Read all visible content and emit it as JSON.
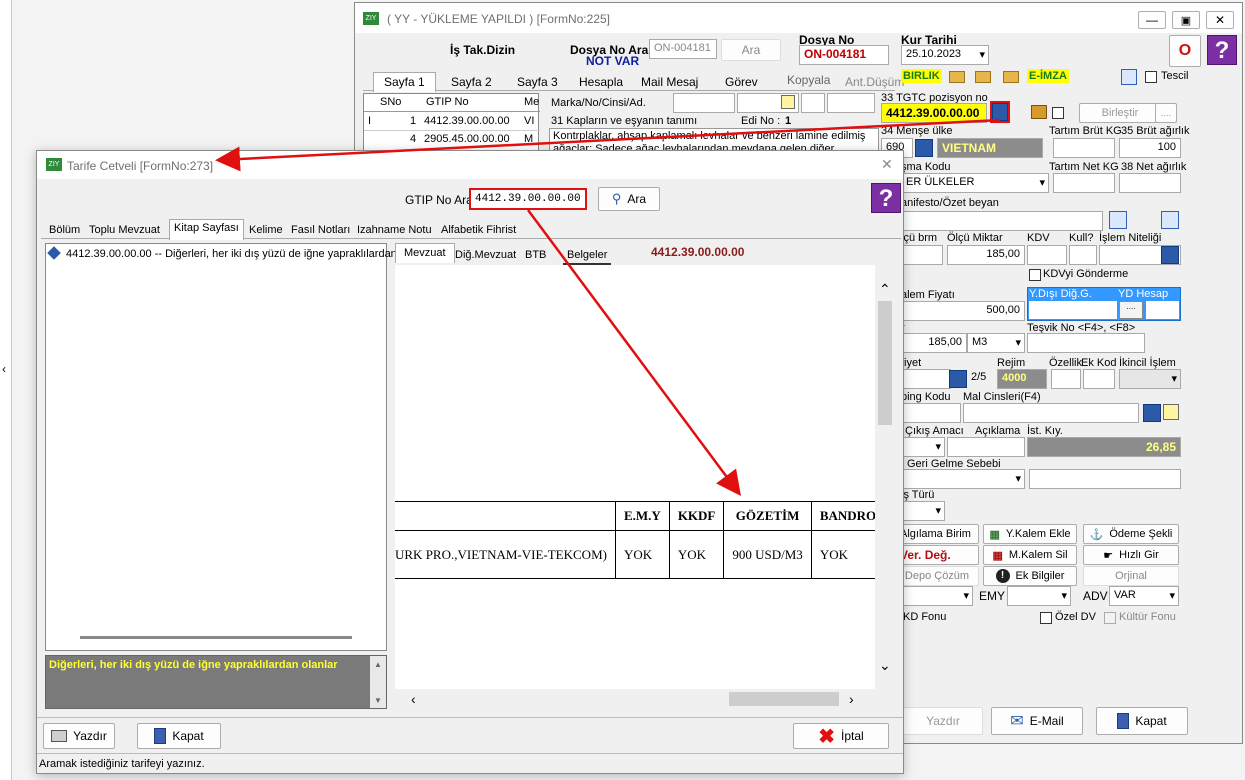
{
  "main_window": {
    "title": "( YY - YÜKLEME YAPILDI ) [FormNo:225]",
    "is_tak_dizin": "İş Tak.Dizin",
    "dosya_no_ara_label": "Dosya No Ara",
    "dosya_no_ara_value": "ON-004181",
    "ara_button": "Ara",
    "not_var": "NOT VAR",
    "dosya_no_label": "Dosya No",
    "dosya_no_value": "ON-004181",
    "kur_tarihi_label": "Kur Tarihi",
    "kur_tarihi_value": "25.10.2023",
    "o_badge": "O",
    "help": "?",
    "tabs": [
      "Sayfa 1",
      "Sayfa 2",
      "Sayfa 3",
      "Hesapla",
      "Mail Mesaj",
      "Görev",
      "Kopyala",
      "Ant.Düşüm"
    ],
    "birlik": "BIRLIK",
    "e_imza": "E-İMZA",
    "tescil": "Tescil",
    "grid_headers": [
      "SNo",
      "GTIP No",
      "Me"
    ],
    "grid_rows": [
      {
        "marker": "I",
        "sno": "1",
        "gtip": "4412.39.00.00.00",
        "me": "VI"
      },
      {
        "marker": "",
        "sno": "4",
        "gtip": "2905.45.00.00.00",
        "me": "M"
      }
    ],
    "marka_label": "Marka/No/Cinsi/Ad.",
    "kaplar_label": "31 Kapların ve eşyanın tanımı",
    "edi_no_label": "Edi No :",
    "edi_no_value": "1",
    "tanim_text": "Kontrplaklar, ahşap kaplamalı levhalar ve benzeri lamine edilmiş ağaçlar; Sadece ağaç levhalarından meydana gelen diğer",
    "tgtc_label": "33 TGTC pozisyon no",
    "tgtc_value": "4412.39.00.00.00",
    "birlestir": "Birleştir",
    "mense_label": "34 Menşe ülke",
    "mense_code": "690",
    "mense_value": "VIETNAM",
    "tartim_brut_label": "Tartım Brüt KG",
    "brut_agirlik_label": "35 Brüt ağırlık",
    "brut_agirlik_value": "100",
    "tartim_net_label": "Tartım Net KG",
    "net_agirlik_label": "38 Net ağırlık",
    "anlasma_label": "şma Kodu",
    "anlasma_value": "ER ÜLKELER",
    "manifesto_label": "anifesto/Özet beyan",
    "olcu_brm_label": "lçü brm",
    "olcu_miktar_label": "Ölçü Miktar",
    "olcu_miktar_value": "185,00",
    "kdv_label": "KDV",
    "kull_label": "Kull?",
    "islem_niteligi_label": "İşlem Niteliği",
    "kdvyi_gonderme": "KDVyi Gönderme",
    "kalem_fiyati_label": "alem Fiyatı",
    "kalem_fiyati_value": "500,00",
    "ydisi_dig_label": "Y.Dışı Diğ.G.",
    "yd_hesap_label": "YD Hesap",
    "r_label": "r",
    "miktar2_value": "185,00",
    "birim_value": "M3",
    "tesvik_label": "Teşvik No <F4>, <F8>",
    "fiyet_label": "fiyet",
    "rejim_label": "Rejim",
    "ozellik_label": "Özellik",
    "ek_kod_label": "Ek Kod",
    "ikincil_label": "İkincil İşlem",
    "sayfa_value": "2/5",
    "rejim_value": "4000",
    "ping_kodu_label": "ping Kodu",
    "mal_cinsleri_label": "Mal Cinsleri(F4)",
    "cikis_amaci_label": "Çıkış Amacı",
    "aciklama_label": "Açıklama",
    "ist_kiy_label": "İst. Kıy.",
    "ist_kiy_value": "26,85",
    "geri_gelme_label": "Geri Gelme Sebebi",
    "is_turu_label": "iş Türü",
    "actions": {
      "alginla_birim": "Algılama Birim",
      "y_kalem_ekle": "Y.Kalem Ekle",
      "odeme_sekli": "Ödeme Şekli",
      "ver_deg": "Ver. Değ.",
      "m_kalem_sil": "M.Kalem Sil",
      "hizli_gir": "Hızlı Gir",
      "depo_cozum": "Depo Çözüm",
      "ek_bilgiler": "Ek Bilgiler",
      "orjinal": "Orjinal"
    },
    "emy_label": "EMY",
    "adv_label": "ADV",
    "adv_value": "VAR",
    "kd_fonu": "KD Fonu",
    "ozel_dv": "Özel DV",
    "kultur_fonu": "Kültür Fonu",
    "yazdir": "Yazdır",
    "email": "E-Mail",
    "kapat": "Kapat"
  },
  "tarife_window": {
    "title": "Tarife Cetveli [FormNo:273]",
    "gtip_no_ara_label": "GTIP No Ara",
    "gtip_no_ara_value": "4412.39.00.00.00",
    "ara_button": "Ara",
    "help": "?",
    "tabs": [
      "Bölüm",
      "Toplu Mevzuat",
      "Kitap Sayfası",
      "Kelime",
      "Fasıl Notları",
      "Izahname Notu",
      "Alfabetik Fihrist"
    ],
    "tree_item": "4412.39.00.00.00 -- Diğerleri, her iki dış yüzü de iğne yapraklılardan",
    "sub_tabs": [
      "Mevzuat",
      "Diğ.Mevzuat",
      "BTB",
      "Belgeler"
    ],
    "sub_code": "4412.39.00.00.00",
    "table_headers": [
      "E.M.Y",
      "KKDF",
      "GÖZETİM",
      "BANDROL"
    ],
    "table_row": [
      "URK PRO.,VIETNAM-VIE-TEKCOM)",
      "YOK",
      "YOK",
      "900 USD/M3",
      "YOK"
    ],
    "description": "Diğerleri, her iki dış yüzü de iğne yapraklılardan olanlar",
    "yazdir": "Yazdır",
    "kapat": "Kapat",
    "iptal": "İptal",
    "status": "Aramak istediğiniz tarifeyi yazınız."
  },
  "colors": {
    "accent_red": "#e01010",
    "vietnam_bg": "#8c8c8c",
    "help_purple": "#7b2fa3",
    "selection_blue": "#3399ff"
  }
}
